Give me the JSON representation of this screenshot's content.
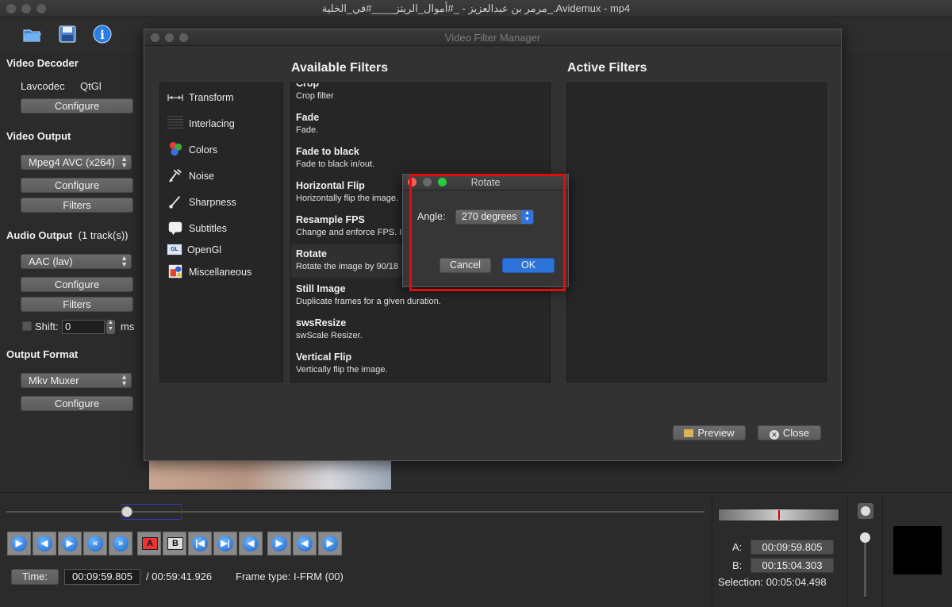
{
  "window": {
    "title": "مرمر بن عبدالعزيز - _#أموال_الريتز____#في_الخلية_.Avidemux - mp4"
  },
  "toolbar": {
    "icons": [
      "open-icon",
      "save-icon",
      "info-icon"
    ]
  },
  "left_panel": {
    "video_decoder": {
      "title": "Video Decoder",
      "codec": "Lavcodec",
      "renderer": "QtGl",
      "configure": "Configure"
    },
    "video_output": {
      "title": "Video Output",
      "codec": "Mpeg4 AVC (x264)",
      "configure": "Configure",
      "filters": "Filters"
    },
    "audio_output": {
      "title": "Audio Output",
      "tracks": "(1 track(s))",
      "codec": "AAC (lav)",
      "configure": "Configure",
      "filters": "Filters",
      "shift_label": "Shift:",
      "shift_value": "0",
      "shift_unit": "ms"
    },
    "output_format": {
      "title": "Output Format",
      "muxer": "Mkv Muxer",
      "configure": "Configure"
    }
  },
  "filter_manager": {
    "title": "Video Filter Manager",
    "available_title": "Available Filters",
    "active_title": "Active Filters",
    "categories": [
      "Transform",
      "Interlacing",
      "Colors",
      "Noise",
      "Sharpness",
      "Subtitles",
      "OpenGl",
      "Miscellaneous"
    ],
    "filters": [
      {
        "name": "Crop",
        "desc": "Crop filter"
      },
      {
        "name": "Fade",
        "desc": "Fade."
      },
      {
        "name": "Fade to black",
        "desc": "Fade to black in/out."
      },
      {
        "name": "Horizontal Flip",
        "desc": "Horizontally flip the image."
      },
      {
        "name": "Resample FPS",
        "desc": "Change and enforce FPS. I"
      },
      {
        "name": "Rotate",
        "desc": "Rotate the image by 90/18"
      },
      {
        "name": "Still Image",
        "desc": "Duplicate frames for a given duration."
      },
      {
        "name": "swsResize",
        "desc": "swScale Resizer."
      },
      {
        "name": "Vertical Flip",
        "desc": "Vertically flip the image."
      }
    ],
    "preview": "Preview",
    "close": "Close"
  },
  "rotate_dialog": {
    "title": "Rotate",
    "angle_label": "Angle:",
    "angle_value": "270 degrees",
    "cancel": "Cancel",
    "ok": "OK"
  },
  "bottom": {
    "time_label": "Time:",
    "time_value": "00:09:59.805",
    "duration": "/ 00:59:41.926",
    "frame_type": "Frame type:  I-FRM (00)",
    "a_label": "A:",
    "a_value": "00:09:59.805",
    "b_label": "B:",
    "b_value": "00:15:04.303",
    "selection": "Selection: 00:05:04.498",
    "nav_labels": [
      "A",
      "B"
    ]
  },
  "colors": {
    "accent": "#2e7be0",
    "highlight": "#e10c0c"
  }
}
